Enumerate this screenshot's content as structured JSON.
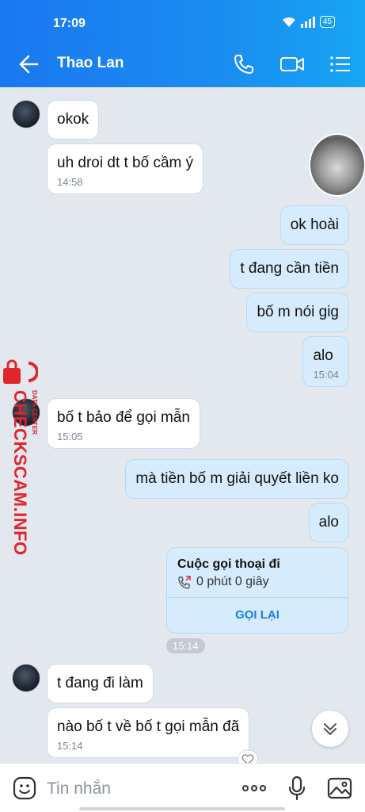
{
  "status_bar": {
    "time": "17:09",
    "battery": "45"
  },
  "header": {
    "title": "Thao Lan"
  },
  "messages": [
    {
      "text": "okok",
      "time": ""
    },
    {
      "text": "uh droi dt t bố cầm ý",
      "time": "14:58"
    },
    {
      "text": "ok hoài",
      "time": ""
    },
    {
      "text": "t đang cần tiền",
      "time": ""
    },
    {
      "text": "bố m nói gig",
      "time": ""
    },
    {
      "text": "alo",
      "time": "15:04"
    },
    {
      "text": "bố t bảo để gọi mẫn",
      "time": "15:05"
    },
    {
      "text": "mà tiền bố m giải quyết liền ko",
      "time": ""
    },
    {
      "text": "alo",
      "time": ""
    },
    {
      "text": "t đang đi làm",
      "time": ""
    },
    {
      "text": "nào bố t về bố t gọi mẫn đã",
      "time": "15:14"
    }
  ],
  "call_card": {
    "title": "Cuộc gọi thoại đi",
    "duration": "0 phút 0 giây",
    "action": "GỌI LẠI"
  },
  "separator_time": "15:14",
  "watermark": {
    "main": "CHECKSCAM.INFO",
    "sub": "DATA CENTER"
  },
  "input": {
    "placeholder": "Tin nhắn"
  },
  "icons": [
    "back-icon",
    "phone-icon",
    "video-icon",
    "menu-icon",
    "sticker-icon",
    "more-icon",
    "mic-icon",
    "image-icon",
    "chevron-down-icon",
    "heart-icon"
  ]
}
